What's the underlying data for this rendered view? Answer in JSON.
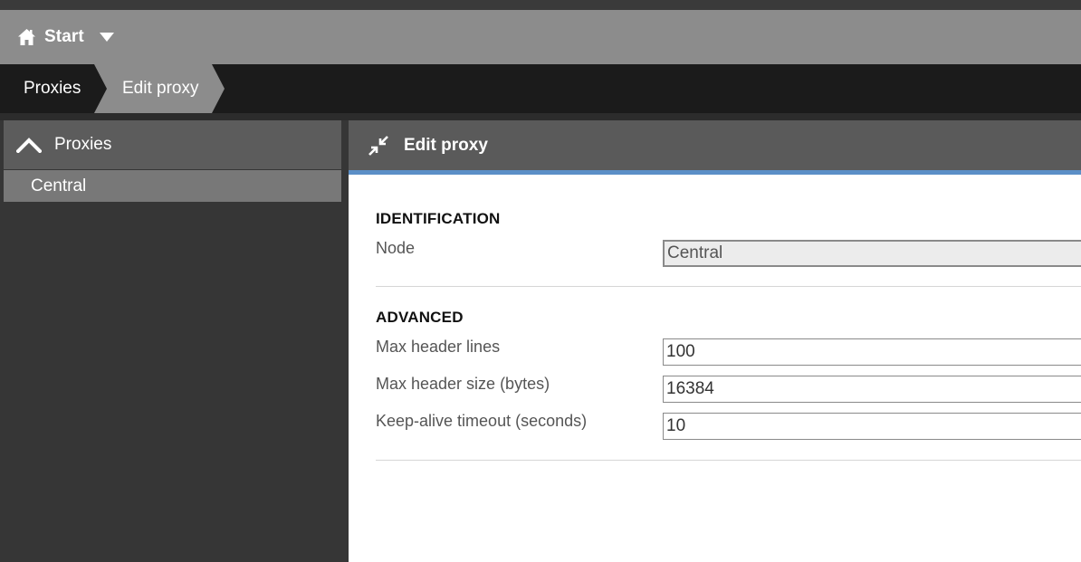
{
  "topbar": {
    "start_label": "Start"
  },
  "breadcrumb": {
    "items": [
      {
        "label": "Proxies"
      },
      {
        "label": "Edit proxy"
      }
    ]
  },
  "sidebar": {
    "header": "Proxies",
    "items": [
      {
        "label": "Central"
      }
    ]
  },
  "panel": {
    "title": "Edit proxy",
    "sections": {
      "identification": {
        "title": "IDENTIFICATION",
        "node_label": "Node",
        "node_value": "Central"
      },
      "advanced": {
        "title": "ADVANCED",
        "max_header_lines_label": "Max header lines",
        "max_header_lines_value": "100",
        "max_header_size_label": "Max header size (bytes)",
        "max_header_size_value": "16384",
        "keepalive_label": "Keep-alive timeout (seconds)",
        "keepalive_value": "10"
      }
    }
  },
  "icons": {
    "home": "home-icon",
    "caret": "caret-down-icon",
    "collapse": "chevron-up-icon",
    "edit_proxy": "collapse-arrows-icon"
  },
  "colors": {
    "topbar": "#8c8c8c",
    "breadcrumb_bg": "#1b1b1b",
    "panel_header": "#5a5a5a",
    "accent": "#5b8fc7",
    "sidebar_header": "#5c5c5c",
    "sidebar_selected": "#787878"
  }
}
